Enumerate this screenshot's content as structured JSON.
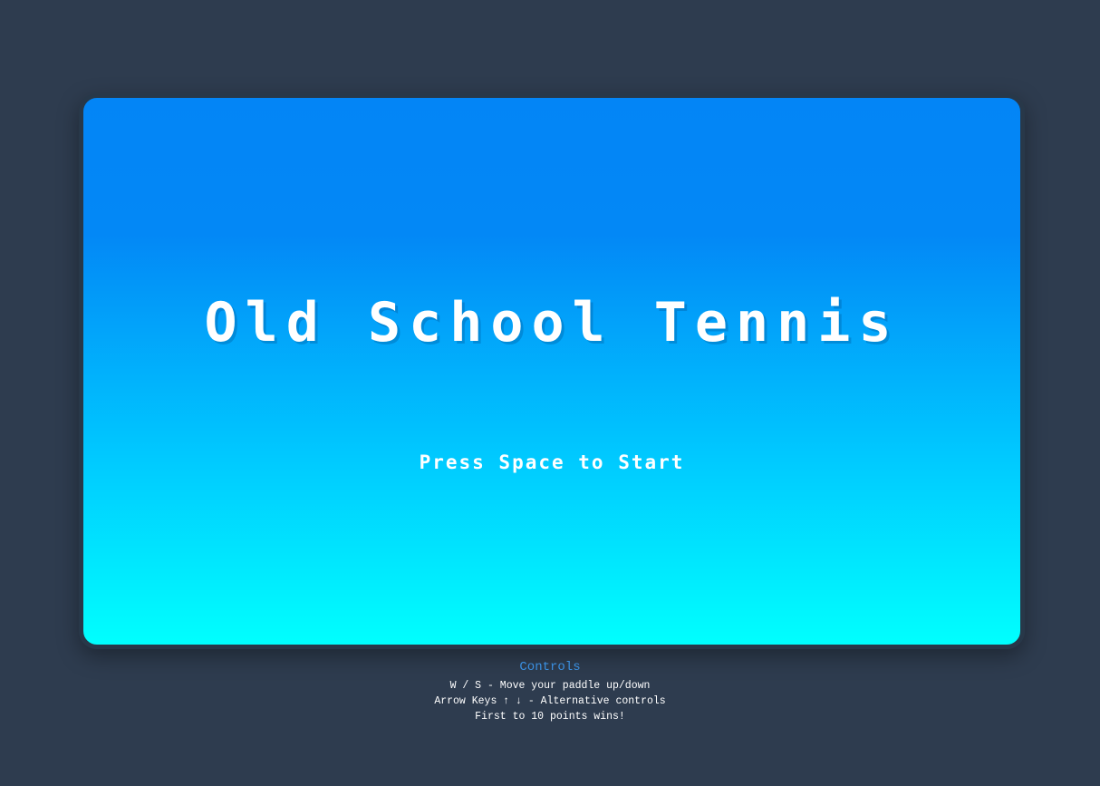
{
  "game": {
    "title": "Old School Tennis",
    "prompt": "Press Space to Start"
  },
  "controls": {
    "heading": "Controls",
    "lines": [
      "W / S - Move your paddle up/down",
      "Arrow Keys ↑ ↓ - Alternative controls",
      "First to 10 points wins!"
    ]
  },
  "colors": {
    "page_background": "#2e3c4f",
    "frame_border": "#283849",
    "gradient_top": "#0385f6",
    "gradient_bottom": "#00fffe",
    "controls_heading": "#3a8fe0",
    "text": "#ffffff"
  }
}
